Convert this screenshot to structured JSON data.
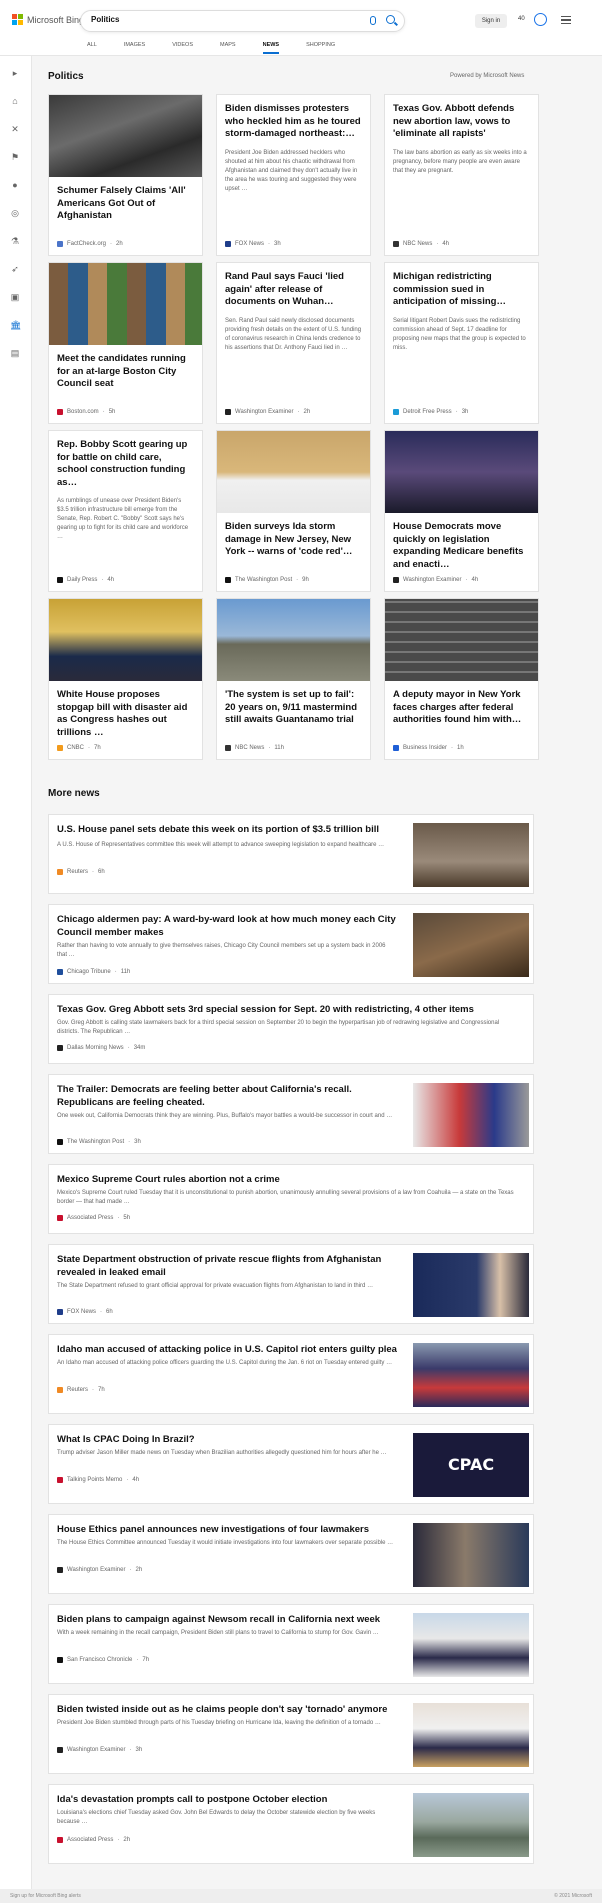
{
  "header": {
    "brand": "Microsoft Bing",
    "search_value": "Politics",
    "signin": "Sign in",
    "points": "40",
    "tabs": [
      {
        "label": "ALL"
      },
      {
        "label": "IMAGES"
      },
      {
        "label": "VIDEOS"
      },
      {
        "label": "MAPS"
      },
      {
        "label": "NEWS"
      },
      {
        "label": "SHOPPING"
      }
    ]
  },
  "section": {
    "title": "Politics",
    "powered": "Powered by Microsoft News"
  },
  "cards": [
    {
      "title": "Schumer Falsely Claims 'All' Americans Got Out of Afghanistan",
      "snippet": "",
      "source": "FactCheck.org",
      "age": "2h",
      "fav": "#4b74c9"
    },
    {
      "title": "Biden dismisses protesters who heckled him as he toured storm-damaged northeast:…",
      "snippet": "President Joe Biden addressed hecklers who shouted at him about his chaotic withdrawal from Afghanistan and claimed they don't actually live in the area he was touring and suggested they were upset …",
      "source": "FOX News",
      "age": "3h",
      "fav": "#1f3d8a"
    },
    {
      "title": "Texas Gov. Abbott defends new abortion law, vows to 'eliminate all rapists'",
      "snippet": "The law bans abortion as early as six weeks into a pregnancy, before many people are even aware that they are pregnant.",
      "source": "NBC News",
      "age": "4h",
      "fav": "#333"
    },
    {
      "title": "Meet the candidates running for an at-large Boston City Council seat",
      "snippet": "",
      "source": "Boston.com",
      "age": "5h",
      "fav": "#c8102e"
    },
    {
      "title": "Rand Paul says Fauci 'lied again' after release of documents on Wuhan…",
      "snippet": "Sen. Rand Paul said newly disclosed documents providing fresh details on the extent of U.S. funding of coronavirus research in China lends credence to his assertions that Dr. Anthony Fauci lied in …",
      "source": "Washington Examiner",
      "age": "2h",
      "fav": "#222"
    },
    {
      "title": "Michigan redistricting commission sued in anticipation of missing…",
      "snippet": "Serial litigant Robert Davis sues the redistricting commission ahead of Sept. 17 deadline for proposing new maps that the group is expected to miss.",
      "source": "Detroit Free Press",
      "age": "3h",
      "fav": "#1a9bd7"
    },
    {
      "title": "Rep. Bobby Scott gearing up for battle on child care, school construction funding as…",
      "snippet": "As rumblings of unease over President Biden's $3.5 trillion infrastructure bill emerge from the Senate, Rep. Robert C. \"Bobby\" Scott says he's gearing up to fight for its child care and workforce …",
      "source": "Daily Press",
      "age": "4h",
      "fav": "#111"
    },
    {
      "title": "Biden surveys Ida storm damage in New Jersey, New York -- warns of 'code red'…",
      "snippet": "",
      "source": "The Washington Post",
      "age": "9h",
      "fav": "#111"
    },
    {
      "title": "House Democrats move quickly on legislation expanding Medicare benefits and enacti…",
      "snippet": "",
      "source": "Washington Examiner",
      "age": "4h",
      "fav": "#222"
    },
    {
      "title": "White House proposes stopgap bill with disaster aid as Congress hashes out trillions …",
      "snippet": "",
      "source": "CNBC",
      "age": "7h",
      "fav": "#f29b1d"
    },
    {
      "title": "'The system is set up to fail': 20 years on, 9/11 mastermind still awaits Guantanamo trial",
      "snippet": "",
      "source": "NBC News",
      "age": "11h",
      "fav": "#333"
    },
    {
      "title": "A deputy mayor in New York faces charges after federal authorities found him with…",
      "snippet": "",
      "source": "Business Insider",
      "age": "1h",
      "fav": "#1f5fd6"
    }
  ],
  "more_news": {
    "title": "More news",
    "items": [
      {
        "title": "U.S. House panel sets debate this week on its portion of $3.5 trillion bill",
        "snippet": "A U.S. House of Representatives committee this week will attempt to advance sweeping legislation to expand healthcare …",
        "source": "Reuters",
        "age": "6h",
        "fav": "#f08a24"
      },
      {
        "title": "Chicago aldermen pay: A ward-by-ward look at how much money each City Council member makes",
        "snippet": "Rather than having to vote annually to give themselves raises, Chicago City Council members set up a system back in 2006 that …",
        "source": "Chicago Tribune",
        "age": "11h",
        "fav": "#1f4e9c"
      },
      {
        "title": "Texas Gov. Greg Abbott sets 3rd special session for Sept. 20 with redistricting, 4 other items",
        "snippet": "Gov. Greg Abbott is calling state lawmakers back for a third special session on September 20 to begin the hyperpartisan job of redrawing legislative and Congressional districts. The Republican …",
        "source": "Dallas Morning News",
        "age": "34m",
        "fav": "#222"
      },
      {
        "title": "The Trailer: Democrats are feeling better about California's recall. Republicans are feeling cheated.",
        "snippet": "One week out, California Democrats think they are winning. Plus, Buffalo's mayor battles a would-be successor in court and …",
        "source": "The Washington Post",
        "age": "3h",
        "fav": "#111"
      },
      {
        "title": "Mexico Supreme Court rules abortion not a crime",
        "snippet": "Mexico's Supreme Court ruled Tuesday that it is unconstitutional to punish abortion, unanimously annulling several provisions of a law from Coahuila — a state on the Texas border — that had made …",
        "source": "Associated Press",
        "age": "5h",
        "fav": "#c8102e"
      },
      {
        "title": "State Department obstruction of private rescue flights from Afghanistan revealed in leaked email",
        "snippet": "The State Department refused to grant official approval for private evacuation flights from Afghanistan to land in third …",
        "source": "FOX News",
        "age": "6h",
        "fav": "#1f3d8a"
      },
      {
        "title": "Idaho man accused of attacking police in U.S. Capitol riot enters guilty plea",
        "snippet": "An Idaho man accused of attacking police officers guarding the U.S. Capitol during the Jan. 6 riot on Tuesday entered guilty …",
        "source": "Reuters",
        "age": "7h",
        "fav": "#f08a24"
      },
      {
        "title": "What Is CPAC Doing In Brazil?",
        "snippet": "Trump adviser Jason Miller made news on Tuesday when Brazilian authorities allegedly questioned him for hours after he …",
        "source": "Talking Points Memo",
        "age": "4h",
        "fav": "#c8102e"
      },
      {
        "title": "House Ethics panel announces new investigations of four lawmakers",
        "snippet": "The House Ethics Committee announced Tuesday it would initiate investigations into four lawmakers over separate possible …",
        "source": "Washington Examiner",
        "age": "2h",
        "fav": "#222"
      },
      {
        "title": "Biden plans to campaign against Newsom recall in California next week",
        "snippet": "With a week remaining in the recall campaign, President Biden still plans to travel to California to stump for Gov. Gavin …",
        "source": "San Francisco Chronicle",
        "age": "7h",
        "fav": "#111"
      },
      {
        "title": "Biden twisted inside out as he claims people don't say 'tornado' anymore",
        "snippet": "President Joe Biden stumbled through parts of his Tuesday briefing on Hurricane Ida, leaving the definition of a tornado …",
        "source": "Washington Examiner",
        "age": "3h",
        "fav": "#222"
      },
      {
        "title": "Ida's devastation prompts call to postpone October election",
        "snippet": "Louisiana's elections chief Tuesday asked Gov. John Bel Edwards to delay the October statewide election by five weeks because …",
        "source": "Associated Press",
        "age": "2h",
        "fav": "#c8102e"
      }
    ]
  },
  "footer": {
    "left": "Sign up for Microsoft Bing alerts",
    "right": "© 2021 Microsoft"
  }
}
